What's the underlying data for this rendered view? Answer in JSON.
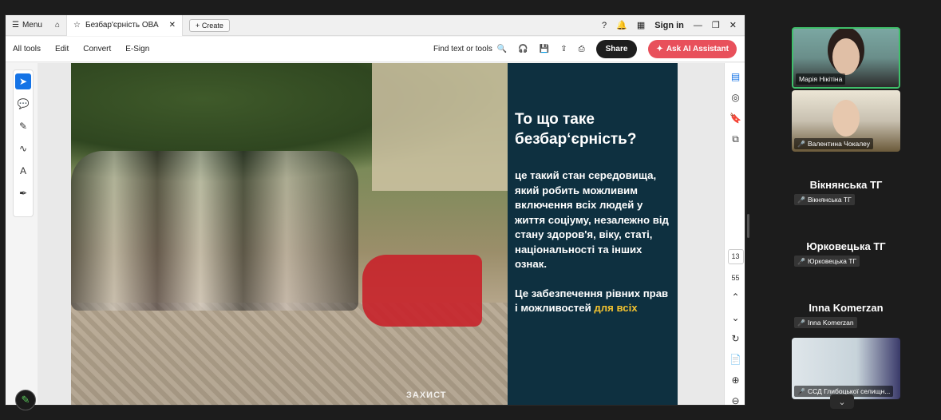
{
  "titlebar": {
    "menu_label": "Menu",
    "tab_title": "Безбар'єрність ОВА",
    "create_label": "Create",
    "sign_in": "Sign in"
  },
  "toolbar": {
    "items": [
      "All tools",
      "Edit",
      "Convert",
      "E-Sign"
    ],
    "find_label": "Find text or tools",
    "share_label": "Share",
    "ai_label": "Ask AI Assistant"
  },
  "slide": {
    "heading": "То що таке безбар‘єрність?",
    "paragraph1": "це такий стан середовища, який робить можливим включення всіх людей у життя соціуму, незалежно від стану здоров'я, віку, статі, національності та інших ознак.",
    "paragraph2_main": "Це забезпечення рівних прав і  можливостей ",
    "paragraph2_highlight": "для всіх",
    "photo_logo": "ЗАХИСТ"
  },
  "viewer": {
    "page_current": "13",
    "page_total": "55"
  },
  "participants": {
    "tiles": [
      {
        "name": "Марія Нікітіна"
      },
      {
        "name": "Валентина Чокалеу"
      }
    ],
    "list": [
      {
        "title": "Вікнянська ТГ",
        "tag": "Вікнянська ТГ"
      },
      {
        "title": "Юрковецька ТГ",
        "tag": "Юрковецька ТГ"
      },
      {
        "title": "Inna Komerzan",
        "tag": "Inna Komerzan"
      }
    ],
    "last_tile": {
      "name": "ССД Глибоцької селищн..."
    }
  },
  "colors": {
    "slide_panel": "#0e3040",
    "highlight": "#f2c230",
    "ai_button": "#e8505b",
    "active_speaker": "#3fbf6a"
  }
}
